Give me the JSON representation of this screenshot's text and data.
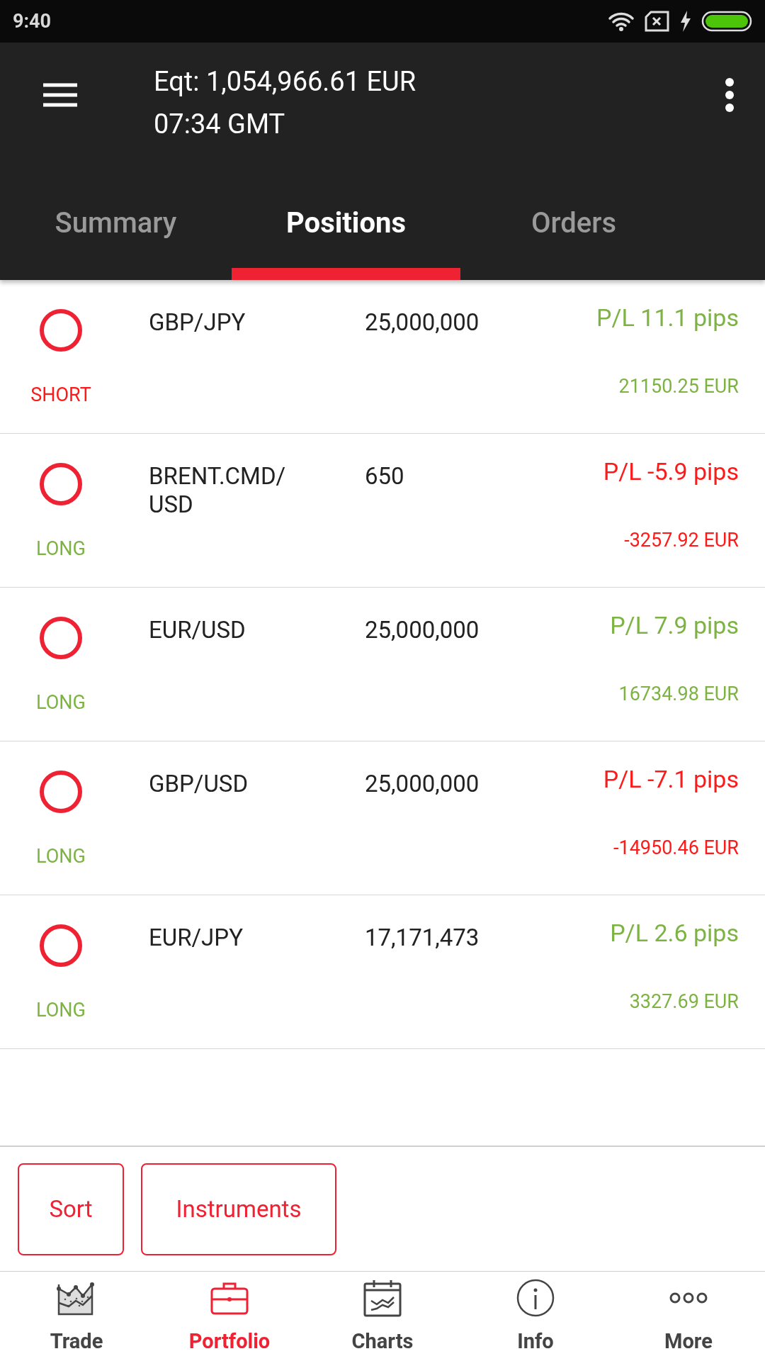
{
  "status_bar": {
    "time": "9:40"
  },
  "header": {
    "equity": "Eqt: 1,054,966.61 EUR",
    "time": "07:34 GMT"
  },
  "tabs": [
    {
      "label": "Summary",
      "selected": false
    },
    {
      "label": "Positions",
      "selected": true
    },
    {
      "label": "Orders",
      "selected": false
    }
  ],
  "positions": [
    {
      "short": true,
      "side_label": "SHORT",
      "instrument": "GBP/JPY",
      "amount": "25,000,000",
      "pl_pips": "P/L 11.1 pips",
      "pl_value": "21150.25 EUR",
      "profit": true
    },
    {
      "short": false,
      "side_label": "LONG",
      "instrument": "BRENT.CMD/ USD",
      "amount": "650",
      "pl_pips": "P/L -5.9 pips",
      "pl_value": "-3257.92 EUR",
      "profit": false
    },
    {
      "short": false,
      "side_label": "LONG",
      "instrument": "EUR/USD",
      "amount": "25,000,000",
      "pl_pips": "P/L 7.9 pips",
      "pl_value": "16734.98 EUR",
      "profit": true
    },
    {
      "short": false,
      "side_label": "LONG",
      "instrument": "GBP/USD",
      "amount": "25,000,000",
      "pl_pips": "P/L -7.1 pips",
      "pl_value": "-14950.46 EUR",
      "profit": false
    },
    {
      "short": false,
      "side_label": "LONG",
      "instrument": "EUR/JPY",
      "amount": "17,171,473",
      "pl_pips": "P/L 2.6 pips",
      "pl_value": "3327.69 EUR",
      "profit": true
    }
  ],
  "buttons": [
    "Sort",
    "Instruments"
  ],
  "bottom_nav": [
    {
      "kind": "trade",
      "label": "Trade",
      "selected": false
    },
    {
      "kind": "portfolio",
      "label": "Portfolio",
      "selected": true
    },
    {
      "kind": "charts",
      "label": "Charts",
      "selected": false
    },
    {
      "kind": "info",
      "label": "Info",
      "selected": false
    },
    {
      "kind": "more",
      "label": "More",
      "selected": false
    }
  ]
}
